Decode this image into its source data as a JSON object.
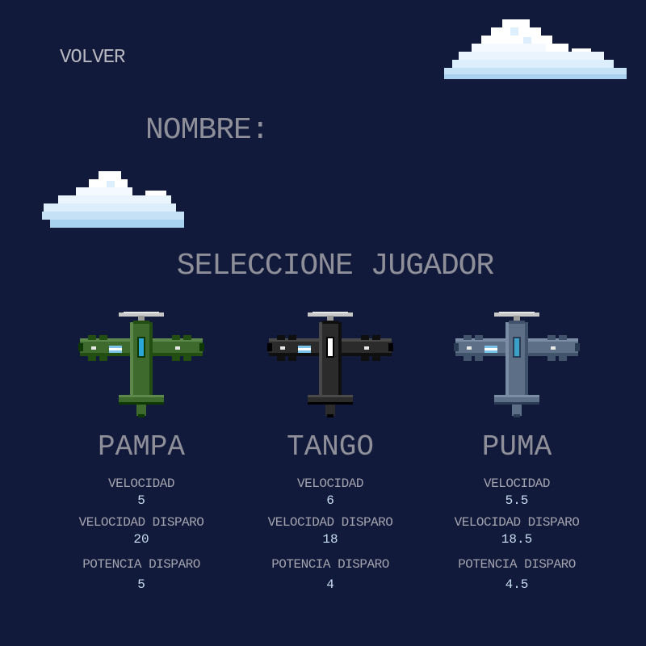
{
  "nav": {
    "back_label": "VOLVER"
  },
  "form": {
    "name_label": "NOMBRE:"
  },
  "title": "SELECCIONE JUGADOR",
  "players": [
    {
      "name": "PAMPA",
      "color": "#3f6a2e",
      "cockpit_color": "#2aa6d8",
      "stats": [
        {
          "label": "VELOCIDAD",
          "value": "5"
        },
        {
          "label": "VELOCIDAD DISPARO",
          "value": "20"
        },
        {
          "label": "POTENCIA DISPARO",
          "value": "5"
        }
      ]
    },
    {
      "name": "TANGO",
      "color": "#2b2b2b",
      "cockpit_color": "#ffffff",
      "stats": [
        {
          "label": "VELOCIDAD",
          "value": "6"
        },
        {
          "label": "VELOCIDAD DISPARO",
          "value": "18"
        },
        {
          "label": "POTENCIA DISPARO",
          "value": "4"
        }
      ]
    },
    {
      "name": "PUMA",
      "color": "#5c6f86",
      "cockpit_color": "#3aa0c8",
      "stats": [
        {
          "label": "VELOCIDAD",
          "value": "5.5"
        },
        {
          "label": "VELOCIDAD DISPARO",
          "value": "18.5"
        },
        {
          "label": "POTENCIA DISPARO",
          "value": "4.5"
        }
      ]
    }
  ]
}
